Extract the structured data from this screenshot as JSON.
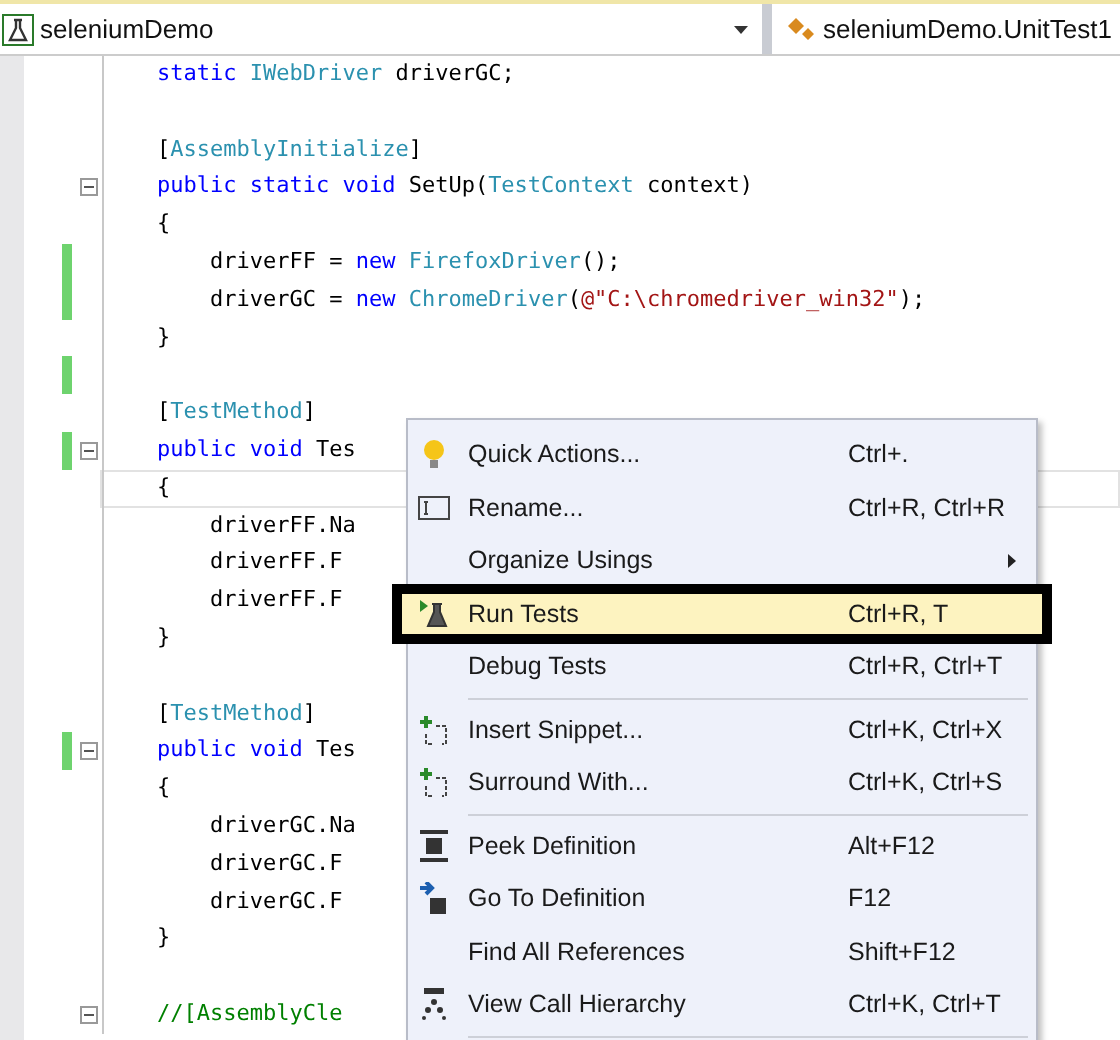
{
  "navigation_bar": {
    "project": "seleniumDemo",
    "class": "seleniumDemo.UnitTest1"
  },
  "code_lines": [
    {
      "changed": false,
      "foldable": false,
      "current": false,
      "tokens": [
        {
          "kind": "keyword",
          "text": "    static"
        },
        {
          "kind": "type",
          "text": " IWebDriver"
        },
        {
          "kind": "plain",
          "text": " driverGC;"
        }
      ]
    },
    {
      "changed": false,
      "foldable": false,
      "current": false
    },
    {
      "changed": false,
      "foldable": false,
      "current": false,
      "tokens": [
        {
          "kind": "plain",
          "text": "    ["
        },
        {
          "kind": "type",
          "text": "AssemblyInitialize"
        },
        {
          "kind": "plain",
          "text": "]"
        }
      ]
    },
    {
      "changed": false,
      "foldable": true,
      "current": false,
      "tokens": [
        {
          "kind": "keyword",
          "text": "    public static void"
        },
        {
          "kind": "plain",
          "text": " SetUp("
        },
        {
          "kind": "type",
          "text": "TestContext"
        },
        {
          "kind": "plain",
          "text": " context)"
        }
      ]
    },
    {
      "changed": false,
      "foldable": false,
      "current": false,
      "tokens": [
        {
          "kind": "plain",
          "text": "    {"
        }
      ]
    },
    {
      "changed": true,
      "foldable": false,
      "current": false,
      "tokens": [
        {
          "kind": "plain",
          "text": "        driverFF = "
        },
        {
          "kind": "keyword",
          "text": "new"
        },
        {
          "kind": "type",
          "text": " FirefoxDriver"
        },
        {
          "kind": "plain",
          "text": "();"
        }
      ]
    },
    {
      "changed": true,
      "foldable": false,
      "current": false,
      "tokens": [
        {
          "kind": "plain",
          "text": "        driverGC = "
        },
        {
          "kind": "keyword",
          "text": "new"
        },
        {
          "kind": "type",
          "text": " ChromeDriver"
        },
        {
          "kind": "plain",
          "text": "("
        },
        {
          "kind": "string",
          "text": "@\"C:\\chromedriver_win32\""
        },
        {
          "kind": "plain",
          "text": ");"
        }
      ]
    },
    {
      "changed": false,
      "foldable": false,
      "current": false,
      "tokens": [
        {
          "kind": "plain",
          "text": "    }"
        }
      ]
    },
    {
      "changed": true,
      "foldable": false,
      "current": false
    },
    {
      "changed": false,
      "foldable": false,
      "current": false,
      "tokens": [
        {
          "kind": "plain",
          "text": "    ["
        },
        {
          "kind": "type",
          "text": "TestMethod"
        },
        {
          "kind": "plain",
          "text": "]"
        }
      ]
    },
    {
      "changed": true,
      "foldable": true,
      "current": false,
      "tokens": [
        {
          "kind": "keyword",
          "text": "    public void"
        },
        {
          "kind": "plain",
          "text": " Tes"
        }
      ]
    },
    {
      "changed": false,
      "foldable": false,
      "current": true,
      "tokens": [
        {
          "kind": "plain",
          "text": "    {"
        }
      ]
    },
    {
      "changed": false,
      "foldable": false,
      "current": false,
      "tokens": [
        {
          "kind": "plain",
          "text": "        driverFF.Na"
        }
      ]
    },
    {
      "changed": false,
      "foldable": false,
      "current": false,
      "tokens": [
        {
          "kind": "plain",
          "text": "        driverFF.F"
        }
      ]
    },
    {
      "changed": false,
      "foldable": false,
      "current": false,
      "tokens": [
        {
          "kind": "plain",
          "text": "        driverFF.F"
        }
      ]
    },
    {
      "changed": false,
      "foldable": false,
      "current": false,
      "tokens": [
        {
          "kind": "plain",
          "text": "    }"
        }
      ]
    },
    {
      "changed": false,
      "foldable": false,
      "current": false
    },
    {
      "changed": false,
      "foldable": false,
      "current": false,
      "tokens": [
        {
          "kind": "plain",
          "text": "    ["
        },
        {
          "kind": "type",
          "text": "TestMethod"
        },
        {
          "kind": "plain",
          "text": "]"
        }
      ]
    },
    {
      "changed": true,
      "foldable": true,
      "current": false,
      "tokens": [
        {
          "kind": "keyword",
          "text": "    public void"
        },
        {
          "kind": "plain",
          "text": " Tes"
        }
      ]
    },
    {
      "changed": false,
      "foldable": false,
      "current": false,
      "tokens": [
        {
          "kind": "plain",
          "text": "    {"
        }
      ]
    },
    {
      "changed": false,
      "foldable": false,
      "current": false,
      "tokens": [
        {
          "kind": "plain",
          "text": "        driverGC.Na"
        }
      ]
    },
    {
      "changed": false,
      "foldable": false,
      "current": false,
      "tokens": [
        {
          "kind": "plain",
          "text": "        driverGC.F"
        }
      ]
    },
    {
      "changed": false,
      "foldable": false,
      "current": false,
      "tokens": [
        {
          "kind": "plain",
          "text": "        driverGC.F"
        }
      ]
    },
    {
      "changed": false,
      "foldable": false,
      "current": false,
      "tokens": [
        {
          "kind": "plain",
          "text": "    }"
        }
      ]
    },
    {
      "changed": false,
      "foldable": false,
      "current": false
    },
    {
      "changed": false,
      "foldable": true,
      "current": false,
      "tokens": [
        {
          "kind": "comment",
          "text": "    //[AssemblyCle"
        }
      ]
    }
  ],
  "context_menu": [
    {
      "kind": "item",
      "label": "Quick Actions...",
      "shortcut": "Ctrl+.",
      "selected": false,
      "submenu": false
    },
    {
      "kind": "item",
      "label": "Rename...",
      "shortcut": "Ctrl+R, Ctrl+R",
      "selected": false,
      "submenu": false
    },
    {
      "kind": "item",
      "label": "Organize Usings",
      "selected": false,
      "submenu": true
    },
    {
      "kind": "item",
      "label": "Run Tests",
      "shortcut": "Ctrl+R, T",
      "selected": true,
      "submenu": false
    },
    {
      "kind": "item",
      "label": "Debug Tests",
      "shortcut": "Ctrl+R, Ctrl+T",
      "selected": false,
      "submenu": false
    },
    {
      "kind": "separator"
    },
    {
      "kind": "item",
      "label": "Insert Snippet...",
      "shortcut": "Ctrl+K, Ctrl+X",
      "selected": false,
      "submenu": false
    },
    {
      "kind": "item",
      "label": "Surround With...",
      "shortcut": "Ctrl+K, Ctrl+S",
      "selected": false,
      "submenu": false
    },
    {
      "kind": "separator"
    },
    {
      "kind": "item",
      "label": "Peek Definition",
      "shortcut": "Alt+F12",
      "selected": false,
      "submenu": false
    },
    {
      "kind": "item",
      "label": "Go To Definition",
      "shortcut": "F12",
      "selected": false,
      "submenu": false
    },
    {
      "kind": "item",
      "label": "Find All References",
      "shortcut": "Shift+F12",
      "selected": false,
      "submenu": false
    },
    {
      "kind": "item",
      "label": "View Call Hierarchy",
      "shortcut": "Ctrl+K, Ctrl+T",
      "selected": false,
      "submenu": false
    },
    {
      "kind": "separator"
    }
  ]
}
